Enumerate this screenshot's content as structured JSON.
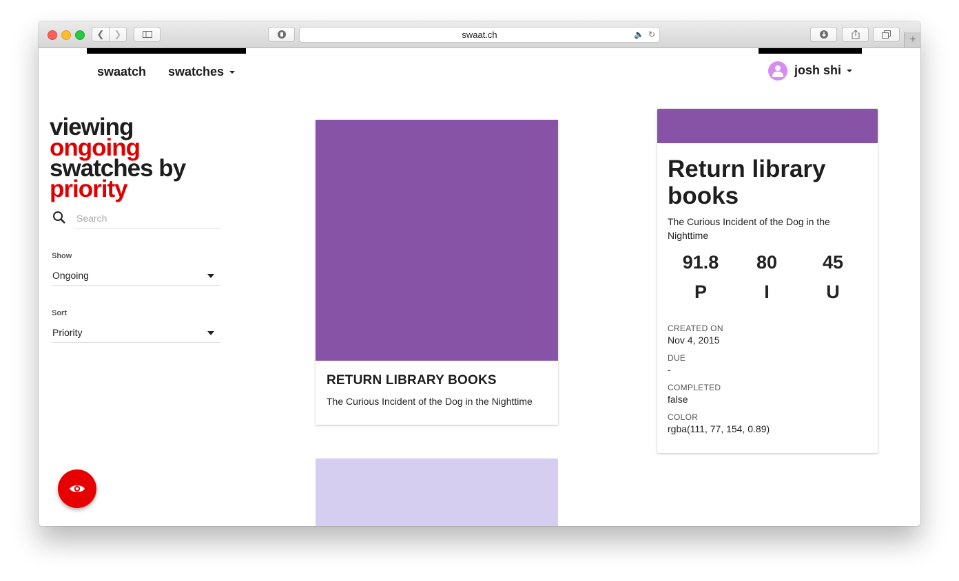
{
  "browser": {
    "url": "swaat.ch"
  },
  "nav": {
    "brand": "swaatch",
    "swatches_menu": "swatches",
    "user_name": "josh shi"
  },
  "sidebar": {
    "heading_line1": "viewing",
    "heading_show": "ongoing",
    "heading_line3": "swatches by",
    "heading_sort": "priority",
    "search_placeholder": "Search",
    "show_label": "Show",
    "show_value": "Ongoing",
    "sort_label": "Sort",
    "sort_value": "Priority"
  },
  "cards": [
    {
      "title": "RETURN LIBRARY BOOKS",
      "subtitle": "The Curious Incident of the Dog in the Nighttime",
      "color": "#8753a6"
    },
    {
      "color": "#d5cef1"
    }
  ],
  "detail": {
    "color": "#8753a6",
    "title": "Return library books",
    "subtitle": "The Curious Incident of the Dog in the Nighttime",
    "stats": [
      {
        "value": "91.8",
        "letter": "P"
      },
      {
        "value": "80",
        "letter": "I"
      },
      {
        "value": "45",
        "letter": "U"
      }
    ],
    "created_label": "CREATED ON",
    "created_value": "Nov 4, 2015",
    "due_label": "DUE",
    "due_value": "-",
    "completed_label": "COMPLETED",
    "completed_value": "false",
    "color_label": "COLOR",
    "color_value": "rgba(111, 77, 154, 0.89)"
  },
  "colors": {
    "accent_red": "#e00000",
    "avatar": "#d68cf0"
  }
}
